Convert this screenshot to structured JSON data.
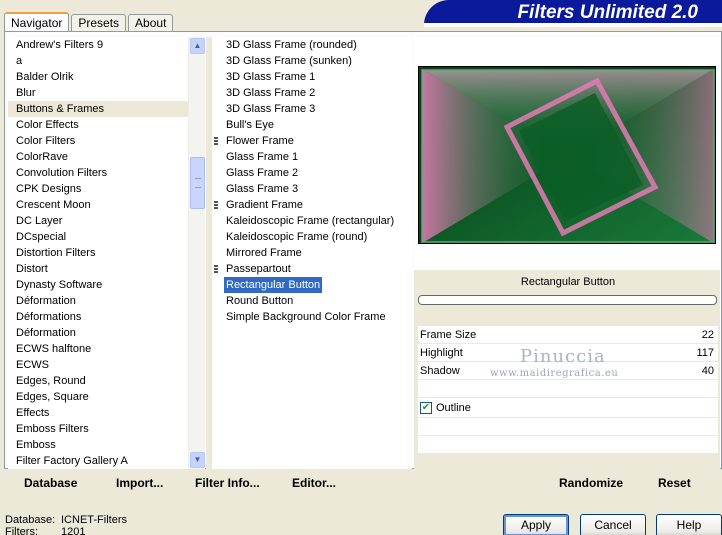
{
  "tabs": [
    {
      "label": "Navigator",
      "active": true
    },
    {
      "label": "Presets",
      "active": false
    },
    {
      "label": "About",
      "active": false
    }
  ],
  "banner": {
    "title": "Filters Unlimited 2.0"
  },
  "categories": [
    "Andrew's Filters 9",
    "a",
    "Balder Olrik",
    "Blur",
    "Buttons & Frames",
    "Color Effects",
    "Color Filters",
    "ColorRave",
    "Convolution Filters",
    "CPK Designs",
    "Crescent Moon",
    "DC Layer",
    "DCspecial",
    "Distortion Filters",
    "Distort",
    "Dynasty Software",
    "Déformation",
    "Déformations",
    "Déformation",
    "ECWS halftone",
    "ECWS",
    "Edges, Round",
    "Edges, Square",
    "Effects",
    "Emboss Filters",
    "Emboss",
    "Filter Factory Gallery A"
  ],
  "selected_category": "Buttons & Frames",
  "filters": [
    {
      "label": "3D Glass Frame (rounded)",
      "mark": false
    },
    {
      "label": "3D Glass Frame (sunken)",
      "mark": false
    },
    {
      "label": "3D Glass Frame 1",
      "mark": false
    },
    {
      "label": "3D Glass Frame 2",
      "mark": false
    },
    {
      "label": "3D Glass Frame 3",
      "mark": false
    },
    {
      "label": "Bull's Eye",
      "mark": false
    },
    {
      "label": "Flower Frame",
      "mark": true
    },
    {
      "label": "Glass Frame 1",
      "mark": false
    },
    {
      "label": "Glass Frame 2",
      "mark": false
    },
    {
      "label": "Glass Frame 3",
      "mark": false
    },
    {
      "label": "Gradient Frame",
      "mark": true
    },
    {
      "label": "Kaleidoscopic Frame (rectangular)",
      "mark": false
    },
    {
      "label": "Kaleidoscopic Frame (round)",
      "mark": false
    },
    {
      "label": "Mirrored Frame",
      "mark": false
    },
    {
      "label": "Passepartout",
      "mark": true
    },
    {
      "label": "Rectangular Button",
      "mark": false
    },
    {
      "label": "Round Button",
      "mark": false
    },
    {
      "label": "Simple Background Color Frame",
      "mark": false
    }
  ],
  "selected_filter": "Rectangular Button",
  "panel": {
    "filter_name": "Rectangular Button",
    "params": [
      {
        "label": "Frame Size",
        "value": "22"
      },
      {
        "label": "Highlight",
        "value": "117"
      },
      {
        "label": "Shadow",
        "value": "40"
      }
    ],
    "outline_label": "Outline",
    "outline_checked": true,
    "watermark": "Pinuccia",
    "watermark_url": "www.maidiregrafica.eu"
  },
  "actions": {
    "database": "Database",
    "import": "Import...",
    "filter_info": "Filter Info...",
    "editor": "Editor...",
    "randomize": "Randomize",
    "reset": "Reset"
  },
  "footer": {
    "database_label": "Database:",
    "database_value": "ICNET-Filters",
    "filters_label": "Filters:",
    "filters_value": "1201",
    "apply": "Apply",
    "cancel": "Cancel",
    "help": "Help"
  },
  "colors": {
    "banner": "#0a1a9a",
    "selection": "#316ac5",
    "preview_green": "#0b6b2c",
    "preview_pink": "#e57ab5"
  },
  "icons": {
    "scroll_up": "chevron-up-icon",
    "scroll_down": "chevron-down-icon"
  }
}
